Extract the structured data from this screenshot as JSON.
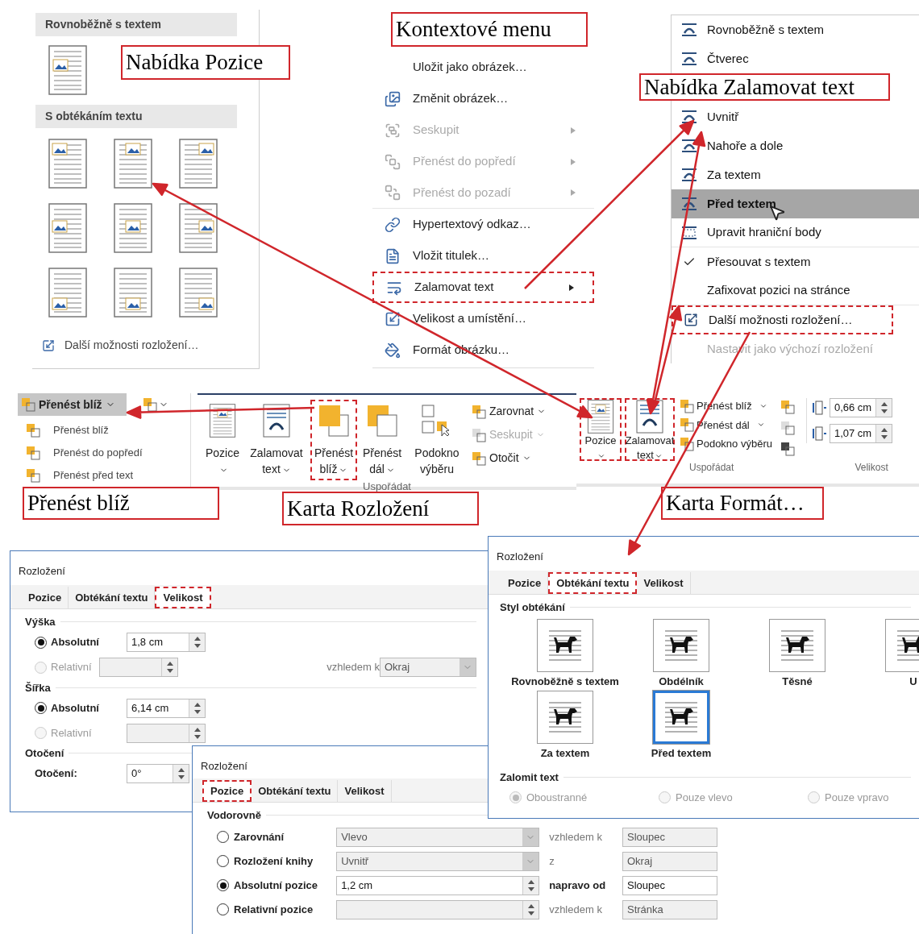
{
  "position_gallery": {
    "sections": [
      "Rovnoběžně s textem",
      "S obtékáním textu"
    ],
    "more_link": "Další možnosti rozložení…"
  },
  "callouts": [
    "Nabídka Pozice",
    "Kontextové menu",
    "Nabídka Zalamovat text",
    "Přenést blíž",
    "Karta Rozložení",
    "Karta Formát…"
  ],
  "context_menu": {
    "items": [
      {
        "label": "Uložit jako obrázek…",
        "disabled": false,
        "submenu": false,
        "highlighted": false
      },
      {
        "label": "Změnit obrázek…",
        "disabled": false,
        "submenu": false,
        "highlighted": false
      },
      {
        "label": "Seskupit",
        "disabled": true,
        "submenu": true,
        "highlighted": false
      },
      {
        "label": "Přenést do popředí",
        "disabled": true,
        "submenu": true,
        "highlighted": false
      },
      {
        "label": "Přenést do pozadí",
        "disabled": true,
        "submenu": true,
        "highlighted": false
      },
      {
        "label": "Hypertextový odkaz…",
        "disabled": false,
        "submenu": false,
        "highlighted": false
      },
      {
        "label": "Vložit titulek…",
        "disabled": false,
        "submenu": false,
        "highlighted": false
      },
      {
        "label": "Zalamovat text",
        "disabled": false,
        "submenu": true,
        "highlighted": true
      },
      {
        "label": "Velikost a umístění…",
        "disabled": false,
        "submenu": false,
        "highlighted": false
      },
      {
        "label": "Formát obrázku…",
        "disabled": false,
        "submenu": false,
        "highlighted": false
      }
    ]
  },
  "wrap_menu": {
    "items": [
      {
        "label": "Rovnoběžně s textem",
        "selected": false,
        "checked": false,
        "disabled": false,
        "highlighted": false
      },
      {
        "label": "Čtverec",
        "selected": false,
        "checked": false,
        "disabled": false,
        "highlighted": false
      },
      {
        "label": "Uvnitř",
        "selected": false,
        "checked": false,
        "disabled": false,
        "highlighted": false
      },
      {
        "label": "Nahoře a dole",
        "selected": false,
        "checked": false,
        "disabled": false,
        "highlighted": false
      },
      {
        "label": "Za textem",
        "selected": false,
        "checked": false,
        "disabled": false,
        "highlighted": false
      },
      {
        "label": "Před textem",
        "selected": true,
        "checked": false,
        "disabled": false,
        "highlighted": false
      },
      {
        "label": "Upravit hraniční body",
        "selected": false,
        "checked": false,
        "disabled": false,
        "highlighted": false
      },
      {
        "label": "Přesouvat s textem",
        "selected": false,
        "checked": true,
        "disabled": false,
        "highlighted": false
      },
      {
        "label": "Zafixovat pozici na stránce",
        "selected": false,
        "checked": false,
        "disabled": false,
        "highlighted": false
      },
      {
        "label": "Další možnosti rozložení…",
        "selected": false,
        "checked": false,
        "disabled": false,
        "highlighted": true
      },
      {
        "label": "Nastavit jako výchozí rozložení",
        "selected": false,
        "checked": false,
        "disabled": true,
        "highlighted": false
      }
    ]
  },
  "bring_forward_dropdown": {
    "button": "Přenést blíž",
    "items": [
      "Přenést blíž",
      "Přenést do popředí",
      "Přenést před text"
    ]
  },
  "layout_ribbon": {
    "large_buttons": [
      {
        "label": "Pozice",
        "dropdown": true,
        "highlighted": false
      },
      {
        "label": "Zalamovat text",
        "dropdown": true,
        "highlighted": false
      },
      {
        "label": "Přenést blíž",
        "dropdown": true,
        "highlighted": true
      },
      {
        "label": "Přenést dál",
        "dropdown": true,
        "highlighted": false
      },
      {
        "label": "Podokno výběru",
        "dropdown": false,
        "highlighted": false
      }
    ],
    "small_buttons": [
      {
        "label": "Zarovnat",
        "disabled": false
      },
      {
        "label": "Seskupit",
        "disabled": true
      },
      {
        "label": "Otočit",
        "disabled": false
      }
    ],
    "group": "Uspořádat"
  },
  "format_ribbon": {
    "large_buttons": [
      {
        "label": "Pozice",
        "dropdown": true,
        "highlighted": true
      },
      {
        "label": "Zalamovat text",
        "dropdown": true,
        "highlighted": true
      }
    ],
    "small_buttons": [
      {
        "label": "Přenést blíž",
        "dropdown": true
      },
      {
        "label": "Přenést dál",
        "dropdown": true
      },
      {
        "label": "Podokno výběru",
        "dropdown": false
      }
    ],
    "group": "Uspořádat",
    "size_fields": [
      "0,66 cm",
      "1,07 cm"
    ],
    "size_group": "Velikost"
  },
  "size_dialog": {
    "title": "Rozložení",
    "tabs": [
      {
        "label": "Pozice",
        "selected": false,
        "highlighted": false
      },
      {
        "label": "Obtékání textu",
        "selected": false,
        "highlighted": false
      },
      {
        "label": "Velikost",
        "selected": true,
        "highlighted": true
      }
    ],
    "sections": [
      {
        "title": "Výška",
        "rows": [
          {
            "kind": "radio",
            "label": "Absolutní",
            "selected": true,
            "disabled": false,
            "value": "1,8 cm"
          },
          {
            "kind": "radio",
            "label": "Relativní",
            "selected": false,
            "disabled": true,
            "relation": "vzhledem k",
            "relation_value": "Okraj"
          }
        ]
      },
      {
        "title": "Šířka",
        "rows": [
          {
            "kind": "radio",
            "label": "Absolutní",
            "selected": true,
            "disabled": false,
            "value": "6,14 cm"
          },
          {
            "kind": "radio",
            "label": "Relativní",
            "selected": false,
            "disabled": true
          }
        ]
      },
      {
        "title": "Otočení",
        "rows": [
          {
            "kind": "plain",
            "label": "Otočení:",
            "disabled": false,
            "value": "0°"
          }
        ]
      }
    ]
  },
  "wrap_dialog": {
    "title": "Rozložení",
    "tabs": [
      {
        "label": "Pozice",
        "selected": false,
        "highlighted": false
      },
      {
        "label": "Obtékání textu",
        "selected": true,
        "highlighted": true
      },
      {
        "label": "Velikost",
        "selected": false,
        "highlighted": false
      }
    ],
    "style_title": "Styl obtékání",
    "styles": [
      {
        "label": "Rovnoběžně s textem",
        "selected": false
      },
      {
        "label": "Obdélník",
        "selected": false
      },
      {
        "label": "Těsné",
        "selected": false
      },
      {
        "label": "U",
        "selected": false
      },
      {
        "label": "Za textem",
        "selected": false
      },
      {
        "label": "Před textem",
        "selected": true
      }
    ],
    "break_title": "Zalomit text",
    "break_options": [
      {
        "label": "Oboustranné",
        "selected": true,
        "disabled": true
      },
      {
        "label": "Pouze vlevo",
        "selected": false,
        "disabled": true
      },
      {
        "label": "Pouze vpravo",
        "selected": false,
        "disabled": true
      }
    ]
  },
  "position_dialog": {
    "title": "Rozložení",
    "tabs": [
      {
        "label": "Pozice",
        "selected": true,
        "highlighted": true
      },
      {
        "label": "Obtékání textu",
        "selected": false,
        "highlighted": false
      },
      {
        "label": "Velikost",
        "selected": false,
        "highlighted": false
      }
    ],
    "section": "Vodorovně",
    "rows": [
      {
        "label": "Zarovnání",
        "selected": false,
        "kind": "dropdown",
        "disabled": true,
        "value": "Vlevo",
        "relation": "vzhledem k",
        "relation_value": "Sloupec"
      },
      {
        "label": "Rozložení knihy",
        "selected": false,
        "kind": "dropdown",
        "disabled": true,
        "value": "Uvnitř",
        "relation": "z",
        "relation_value": "Okraj"
      },
      {
        "label": "Absolutní pozice",
        "selected": true,
        "kind": "spinner",
        "disabled": false,
        "value": "1,2 cm",
        "relation": "napravo od",
        "relation_value": "Sloupec"
      },
      {
        "label": "Relativní pozice",
        "selected": false,
        "kind": "spinner",
        "disabled": true,
        "relation": "vzhledem k",
        "relation_value": "Stránka"
      }
    ]
  }
}
